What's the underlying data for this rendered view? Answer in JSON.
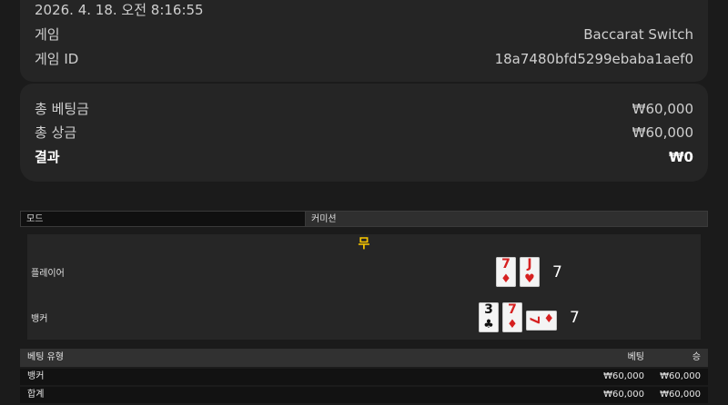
{
  "info": {
    "datetime": "2026. 4. 18. 오전 8:16:55",
    "game_label": "게임",
    "game_value": "Baccarat Switch",
    "game_id_label": "게임 ID",
    "game_id_value": "18a7480bfd5299ebaba1aef0"
  },
  "summary": {
    "total_bet_label": "총 베팅금",
    "total_bet_value": "₩60,000",
    "total_win_label": "총 상금",
    "total_win_value": "₩60,000",
    "result_label": "결과",
    "result_value": "₩0"
  },
  "mode": {
    "mode_label": "모드",
    "commission_label": "커미션"
  },
  "round": {
    "outcome": "무",
    "player_label": "플레이어",
    "player_cards": [
      {
        "rank": "7",
        "suit": "♦",
        "color": "#d62020"
      },
      {
        "rank": "J",
        "suit": "♥",
        "color": "#d62020"
      }
    ],
    "player_score": "7",
    "banker_label": "뱅커",
    "banker_cards": [
      {
        "rank": "3",
        "suit": "♣",
        "color": "#111111"
      },
      {
        "rank": "7",
        "suit": "♦",
        "color": "#d62020"
      },
      {
        "rank": "7",
        "suit": "♦",
        "color": "#d62020",
        "sideways": true
      }
    ],
    "banker_score": "7"
  },
  "bets": {
    "headers": {
      "type": "베팅 유형",
      "bet": "베팅",
      "win": "승"
    },
    "rows": [
      {
        "type": "뱅커",
        "bet": "₩60,000",
        "win": "₩60,000"
      },
      {
        "type": "합계",
        "bet": "₩60,000",
        "win": "₩60,000"
      }
    ]
  },
  "colors": {
    "outcome": "#f5c400",
    "background": "#1b1b1b",
    "card_panel": "#252525"
  }
}
